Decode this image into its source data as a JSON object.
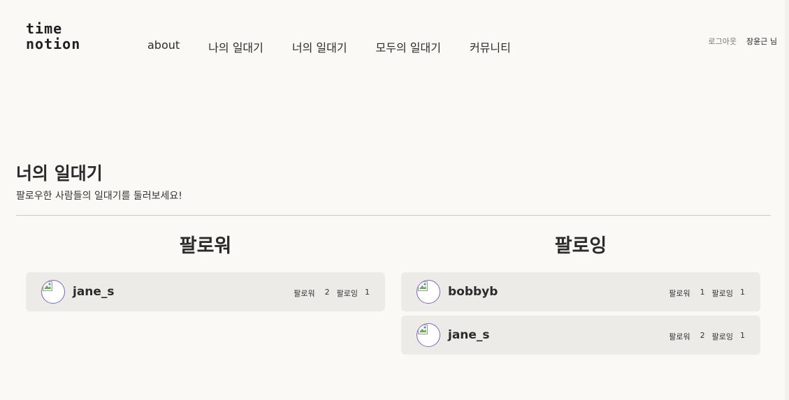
{
  "header": {
    "logo_line1": "time",
    "logo_line2": "notion",
    "nav": [
      "about",
      "나의 일대기",
      "너의 일대기",
      "모두의 일대기",
      "커뮤니티"
    ],
    "logout": "로그아웃",
    "username": "장윤근 님"
  },
  "page": {
    "title": "너의 일대기",
    "subtitle": "팔로우한 사람들의 일대기를 둘러보세요!"
  },
  "followers": {
    "title": "팔로워",
    "items": [
      {
        "name": "jane_s",
        "follower_label": "팔로워",
        "follower_count": "2",
        "following_label": "팔로잉",
        "following_count": "1"
      }
    ]
  },
  "following": {
    "title": "팔로잉",
    "items": [
      {
        "name": "bobbyb",
        "follower_label": "팔로워",
        "follower_count": "1",
        "following_label": "팔로잉",
        "following_count": "1"
      },
      {
        "name": "jane_s",
        "follower_label": "팔로워",
        "follower_count": "2",
        "following_label": "팔로잉",
        "following_count": "1"
      }
    ]
  }
}
